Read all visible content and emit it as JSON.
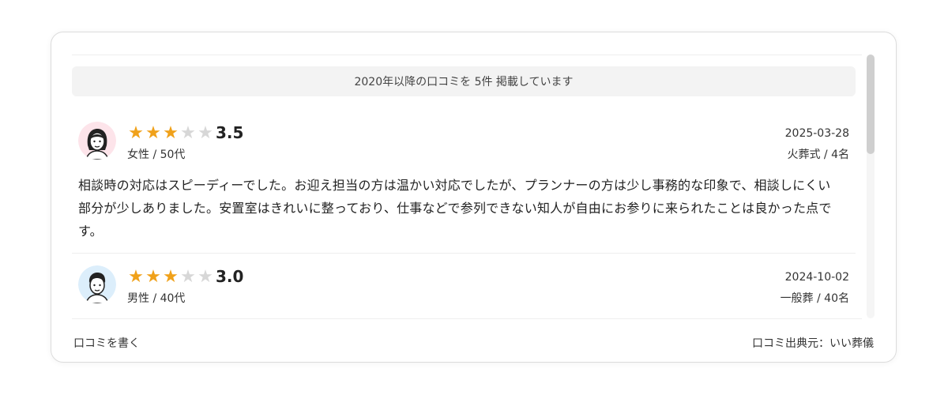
{
  "summary": "2020年以降の口コミを 5件 掲載しています",
  "reviews": [
    {
      "rating": 3.5,
      "score_text": "3.5",
      "reviewer": "女性 / 50代",
      "date": "2025-03-28",
      "ceremony": "火葬式 / 4名",
      "avatar": "woman-avatar-icon",
      "avatar_bg": "#fde4ea",
      "body": "相談時の対応はスピーディーでした。お迎え担当の方は温かい対応でしたが、プランナーの方は少し事務的な印象で、相談しにくい部分が少しありました。安置室はきれいに整っており、仕事などで参列できない知人が自由にお参りに来られたことは良かった点です。"
    },
    {
      "rating": 3.0,
      "score_text": "3.0",
      "reviewer": "男性 / 40代",
      "date": "2024-10-02",
      "ceremony": "一般葬 / 40名",
      "avatar": "man-avatar-icon",
      "avatar_bg": "#dceefb"
    }
  ],
  "footer": {
    "write_review": "口コミを書く",
    "source": "口コミ出典元：いい葬儀"
  },
  "colors": {
    "star_on": "#f0a11a",
    "star_off": "#d7d7d7"
  }
}
